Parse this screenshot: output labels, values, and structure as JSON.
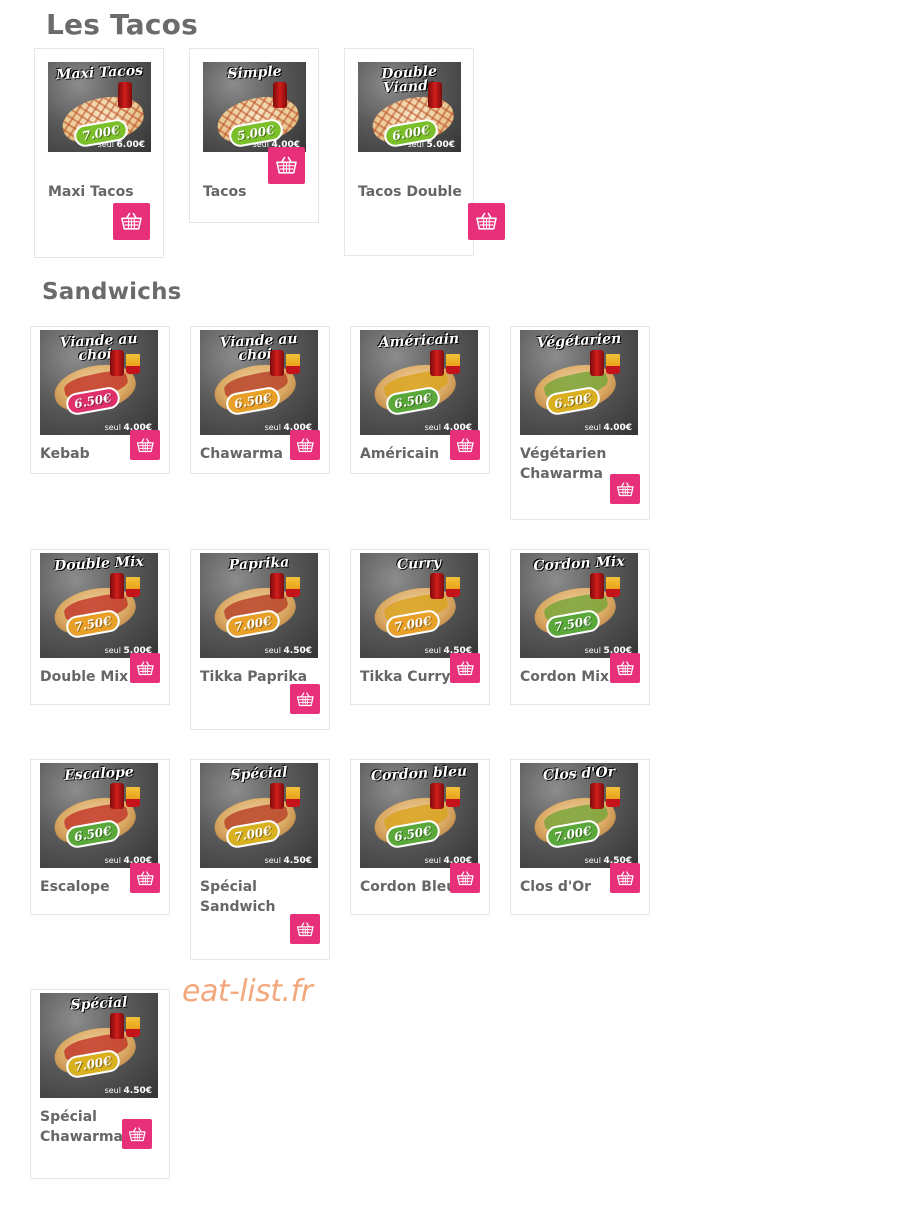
{
  "sections": {
    "tacos_title": "Les Tacos",
    "sandwichs_title": "Sandwichs"
  },
  "watermark": "eat-list.fr",
  "colors": {
    "basket_button": "#e8307a",
    "section_title": "#6b6b6b",
    "item_name": "#666666",
    "watermark": "#f2a77c"
  },
  "icons": {
    "basket": "shopping-basket-icon"
  },
  "tacos": [
    {
      "name": "Maxi Tacos",
      "banner": "Maxi Tacos",
      "price": "7.00€",
      "seul": "6.00€",
      "price_color": "#7bbf2a"
    },
    {
      "name": "Tacos",
      "banner": "Simple",
      "price": "5.00€",
      "seul": "4.00€",
      "price_color": "#7bbf2a"
    },
    {
      "name": "Tacos Double",
      "banner": "Double Viande",
      "price": "6.00€",
      "seul": "5.00€",
      "price_color": "#7bbf2a"
    }
  ],
  "sandwichs": [
    {
      "name": "Kebab",
      "banner": "Viande au choix",
      "price": "6.50€",
      "seul": "4.00€",
      "price_color": "#e0306a"
    },
    {
      "name": "Chawarma",
      "banner": "Viande au choix",
      "price": "6.50€",
      "seul": "4.00€",
      "price_color": "#e8a028"
    },
    {
      "name": "Américain",
      "banner": "Américain",
      "price": "6.50€",
      "seul": "4.00€",
      "price_color": "#5aa83a"
    },
    {
      "name": "Végétarien\nChawarma",
      "banner": "Végétarien",
      "price": "6.50€",
      "seul": "4.00€",
      "price_color": "#d8b020"
    },
    {
      "name": "Double Mix",
      "banner": "Double Mix",
      "price": "7.50€",
      "seul": "5.00€",
      "price_color": "#e8a028"
    },
    {
      "name": "Tikka Paprika",
      "banner": "Paprika",
      "price": "7.00€",
      "seul": "4.50€",
      "price_color": "#e8a028"
    },
    {
      "name": "Tikka Curry",
      "banner": "Curry",
      "price": "7.00€",
      "seul": "4.50€",
      "price_color": "#e8a028"
    },
    {
      "name": "Cordon Mix",
      "banner": "Cordon Mix",
      "price": "7.50€",
      "seul": "5.00€",
      "price_color": "#5aa83a"
    },
    {
      "name": "Escalope",
      "banner": "Escalope",
      "price": "6.50€",
      "seul": "4.00€",
      "price_color": "#5aa83a"
    },
    {
      "name": "Spécial\nSandwich",
      "banner": "Spécial",
      "price": "7.00€",
      "seul": "4.50€",
      "price_color": "#d8b020"
    },
    {
      "name": "Cordon Bleu",
      "banner": "Cordon bleu",
      "price": "6.50€",
      "seul": "4.00€",
      "price_color": "#5aa83a"
    },
    {
      "name": "Clos d'Or",
      "banner": "Clos d'Or",
      "price": "7.00€",
      "seul": "4.50€",
      "price_color": "#5aa83a"
    },
    {
      "name": "Spécial\nChawarma",
      "banner": "Spécial",
      "price": "7.00€",
      "seul": "4.50€",
      "price_color": "#d8b020"
    }
  ]
}
